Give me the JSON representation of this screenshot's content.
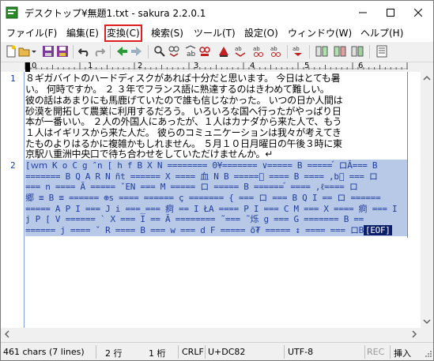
{
  "window": {
    "title": "デスクトップ¥無題1.txt - sakura 2.2.0.1"
  },
  "menu": [
    {
      "label": "ファイル(F)"
    },
    {
      "label": "編集(E)"
    },
    {
      "label": "変換(C)"
    },
    {
      "label": "検索(S)"
    },
    {
      "label": "ツール(T)"
    },
    {
      "label": "設定(O)"
    },
    {
      "label": "ウィンドウ(W)"
    },
    {
      "label": "ヘルプ(H)"
    }
  ],
  "ruler": {
    "marks": [
      "0",
      "1",
      "2",
      "3",
      "4",
      "5",
      "6"
    ]
  },
  "editor": {
    "line_numbers": [
      "1",
      "2"
    ],
    "line1_text": [
      "８ギガバイトのハードディスクがあれば十分だと思います。 今日はとても暑",
      "い。 何時ですか。 ２ ３年でフランス語に熟達するのはきわめて難しい。",
      "彼の話はあまりにも馬鹿げていたので誰も信じなかった。 いつの日か人間は",
      "砂漠を開拓して農業に利用するだろう。 いろいろな国へ行ったがやっぱり日",
      "本が一番いい。 ２人の外国人にあったが、１人はカナダから来た人で、もう",
      "１人はイギリスから来た人だ。 彼らのコミュニケーションは我々が考えてき",
      "たものよりはるかに複雑かもしれません。 ５月１０日月曜日の午後３時に東",
      "京駅八重洲中央口で待ち合わせをしていただけませんか。↵"
    ],
    "line2_text": [
      "[ｗｍ K o C g ″n [ h f B X N   ======== 0¥=======  ∨=====  B =====  ゙ ロĂ=== B",
      "=======  B  Q A R N ñt ====== X  ==== 血 N  B =====゙  ==== B ==== ,b゙ ===  ロ",
      "=== n  ==== Ă ===== ˇΕN ===  M  =====  ロ  ===== B ====== ゙ ==== ,ℓ====  ロ",
      "郷 ≡  B  ≡ ====== ⊕s ==== ====== ç ======= { ===  ロ === B  Q I ==  ロ ======",
      "=====  A P I === J i ===_=== 痾 ==  I ŁA ==== P I ===  C M === X ==== 痾 ===  I ",
      "j P [ V ====== ` X ===  I ==  Ă ========  ̃  ===  ̃ 烁 g === G ======= B ==",
      "====== j ==== ˇ  R  ==== B ===  w === d F ===== õ₮ ===== ↕ ====  ===  ロB"
    ],
    "eof_label": "[EOF]"
  },
  "status": {
    "chars": "461 chars (7 lines)",
    "row": "2 行",
    "col": "1 桁",
    "eol": "CRLF",
    "code": "U+DC82",
    "encoding": "UTF-8",
    "rec": "REC",
    "mode": "挿入"
  },
  "colors": {
    "selection": "#b7c9e6",
    "line_number": "#1a3aa8",
    "wrap_marker": "#e040e0",
    "highlight_box": "#e02020"
  },
  "toolbar_icons": [
    "new-file-icon",
    "open-folder-icon",
    "save-icon",
    "save-all-icon",
    "undo-icon",
    "redo-icon",
    "jump-back-icon",
    "jump-forward-icon",
    "find-icon",
    "find-prev-icon",
    "find-next-icon",
    "replace-icon",
    "mark-icon",
    "grep-icon",
    "tag-jump-icon",
    "outline-icon",
    "compare-icon",
    "diff-icon",
    "settings-icon"
  ]
}
